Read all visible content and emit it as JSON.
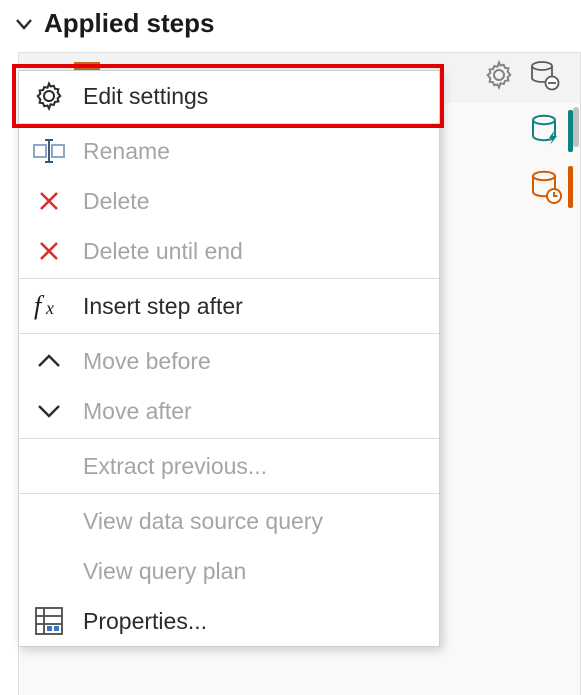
{
  "header": {
    "title": "Applied steps"
  },
  "step": {
    "name": ""
  },
  "menu": {
    "edit_settings": "Edit settings",
    "rename": "Rename",
    "delete": "Delete",
    "delete_until_end": "Delete until end",
    "insert_step_after": "Insert step after",
    "move_before": "Move before",
    "move_after": "Move after",
    "extract_previous": "Extract previous...",
    "view_data_source_query": "View data source query",
    "view_query_plan": "View query plan",
    "properties": "Properties..."
  },
  "icons": {
    "gear": "gear-icon",
    "db_remove": "database-remove-icon",
    "db_bolt": "database-bolt-icon",
    "db_clock": "database-clock-icon"
  }
}
